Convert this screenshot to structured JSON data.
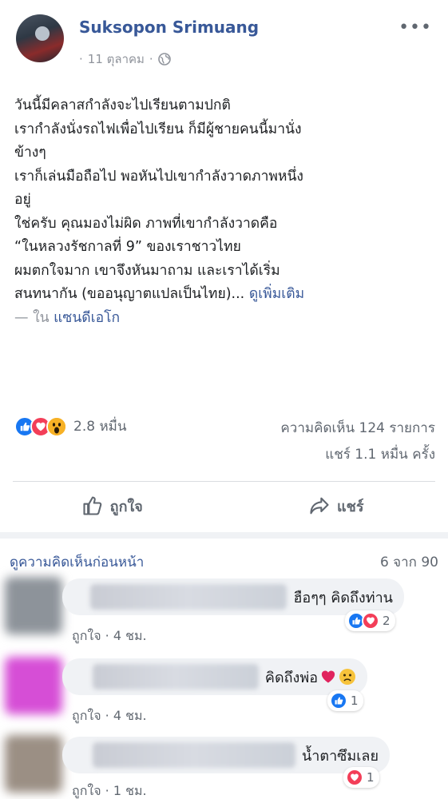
{
  "post": {
    "author": "Suksopon Srimuang",
    "date": "11 ตุลาคม",
    "date_separator": "·",
    "more_label": "•••",
    "lines": [
      "วันนี้มีคลาสกำลังจะไปเรียนตามปกติ",
      "เรากำลังนั่งรถไฟเพื่อไปเรียน ก็มีผู้ชายคนนี้มานั่ง",
      "ข้างๆ",
      "เราก็เล่นมือถือไป พอหันไปเขากำลังวาดภาพหนึ่ง",
      "อยู่",
      "ใช่ครับ คุณมองไม่ผิด ภาพที่เขากำลังวาดคือ",
      "“ในหลวงรัชกาลที่ 9” ของเราชาวไทย",
      "ผมตกใจมาก เขาจึงหันมาถาม และเราได้เริ่ม"
    ],
    "last_line": "สนทนากัน (ขออนุญาตแปลเป็นไทย)...",
    "see_more": "ดูเพิ่มเติม",
    "location_prefix": "— ใน",
    "location": "แซนดีเอโก"
  },
  "stats": {
    "reactions": "2.8 หมื่น",
    "comments": "ความคิดเห็น 124 รายการ",
    "shares": "แชร์ 1.1 หมื่น ครั้ง"
  },
  "actions": {
    "like": "ถูกใจ",
    "share": "แชร์"
  },
  "comments_section": {
    "view_previous": "ดูความคิดเห็นก่อนหน้า",
    "paging": "6 จาก 90",
    "items": [
      {
        "text": "ฮือๆๆ คิดถึงท่าน",
        "reaction_count": "2",
        "like_label": "ถูกใจ",
        "time": "· 4 ชม.",
        "avatar_color": "#8d939a",
        "reactions": [
          "like",
          "love"
        ]
      },
      {
        "text": "คิดถึงพ่อ",
        "reaction_count": "1",
        "like_label": "ถูกใจ",
        "time": "· 4 ชม.",
        "avatar_color": "#d64ed6",
        "reactions": [
          "like"
        ]
      },
      {
        "text": "น้ำตาซึมเลย",
        "reaction_count": "1",
        "like_label": "ถูกใจ",
        "time": "· 1 ชม.",
        "avatar_color": "#9b8f84",
        "reactions": [
          "love"
        ]
      }
    ]
  },
  "colors": {
    "link": "#385898",
    "like_blue": "#1877f2",
    "love_red": "#f33e58",
    "wow_yellow": "#f7b125",
    "muted": "#606770"
  }
}
